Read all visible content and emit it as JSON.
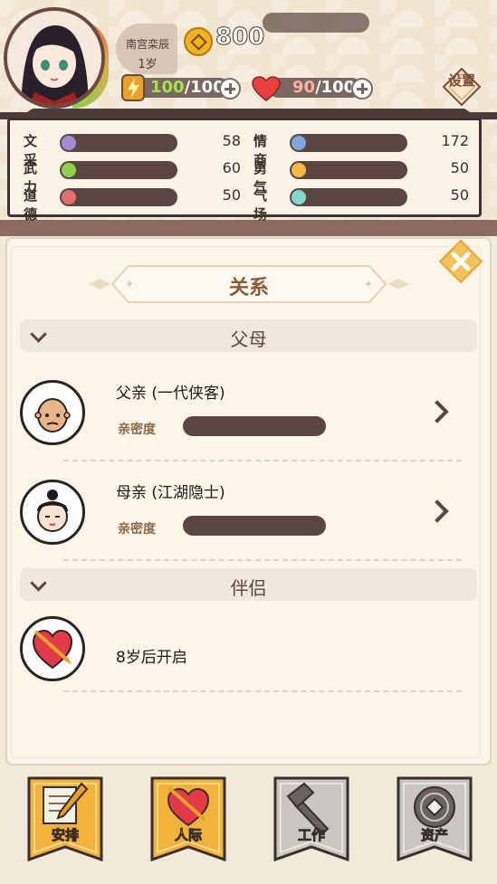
{
  "player": {
    "name": "南宫栾辰",
    "age": "1岁",
    "coins": "800"
  },
  "energy": {
    "current": "100",
    "max": "/100"
  },
  "health": {
    "current": "90",
    "max": "/100"
  },
  "settings_label": "设置",
  "stats": [
    {
      "label": "文采",
      "value": "58",
      "color": "#a68ad6"
    },
    {
      "label": "情商",
      "value": "172",
      "color": "#7ea6dc"
    },
    {
      "label": "武力",
      "value": "60",
      "color": "#8fd04f"
    },
    {
      "label": "勇气",
      "value": "50",
      "color": "#f2bb47"
    },
    {
      "label": "道德",
      "value": "50",
      "color": "#e16f6f"
    },
    {
      "label": "气场",
      "value": "50",
      "color": "#7fd9cf"
    }
  ],
  "panel": {
    "title": "关系",
    "sections": {
      "parents": "父母",
      "partner": "伴侣"
    },
    "father": {
      "name": "父亲 (一代侠客)",
      "intimacy_label": "亲密度"
    },
    "mother": {
      "name": "母亲 (江湖隐士)",
      "intimacy_label": "亲密度"
    },
    "partner_unlock": "8岁后开启"
  },
  "tabs": [
    {
      "label": "安排",
      "icon": "pencil-paper-icon"
    },
    {
      "label": "人际",
      "icon": "heart-arrow-icon"
    },
    {
      "label": "工作",
      "icon": "hammer-icon"
    },
    {
      "label": "资产",
      "icon": "coin-icon"
    }
  ]
}
